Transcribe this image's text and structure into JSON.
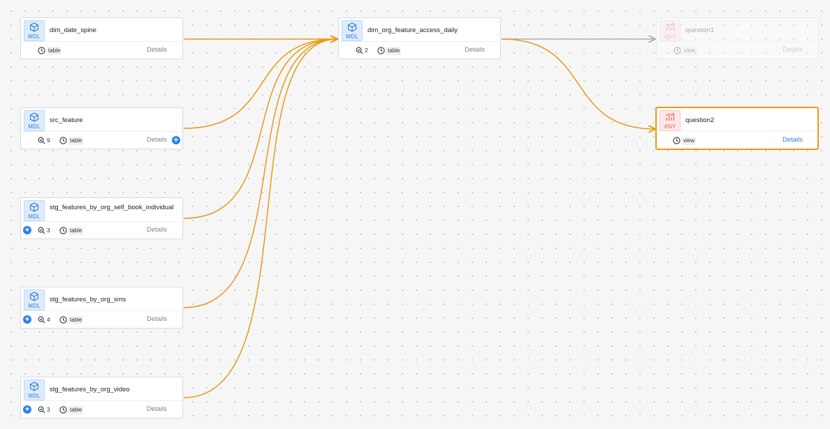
{
  "colors": {
    "edge_active": "#e69a12",
    "edge_inactive": "#a9b0b8",
    "mdl_accent": "#2f7bd6",
    "any_accent": "#e0675d",
    "plus_button": "#2f83e3"
  },
  "models": {
    "dim_date_spine": {
      "badge": "MDL",
      "name": "dim_date_spine",
      "type_label": "table",
      "details_label": "Details"
    },
    "src_feature": {
      "badge": "MDL",
      "name": "src_feature",
      "test_count": "9",
      "type_label": "table",
      "details_label": "Details"
    },
    "stg_self_book": {
      "badge": "MDL",
      "name": "stg_features_by_org_self_book_individual",
      "test_count": "3",
      "type_label": "table",
      "details_label": "Details"
    },
    "stg_sms": {
      "badge": "MDL",
      "name": "stg_features_by_org_sms",
      "test_count": "4",
      "type_label": "table",
      "details_label": "Details"
    },
    "stg_video": {
      "badge": "MDL",
      "name": "stg_features_by_org_video",
      "test_count": "3",
      "type_label": "table",
      "details_label": "Details"
    },
    "dim_org": {
      "badge": "MDL",
      "name": "dim_org_feature_access_daily",
      "test_count": "2",
      "type_label": "table",
      "details_label": "Details"
    }
  },
  "questions": {
    "question1": {
      "badge": "ANY",
      "name": "question1",
      "type_label": "view",
      "details_label": "Details"
    },
    "question2": {
      "badge": "ANY",
      "name": "question2",
      "type_label": "view",
      "details_label": "Details"
    }
  },
  "selected_node": "question2",
  "icons": {
    "model": "cube-icon",
    "question": "bar-chart-icon",
    "tests": "magnifier-check-icon",
    "type": "clock-icon",
    "expand": "plus-icon"
  }
}
